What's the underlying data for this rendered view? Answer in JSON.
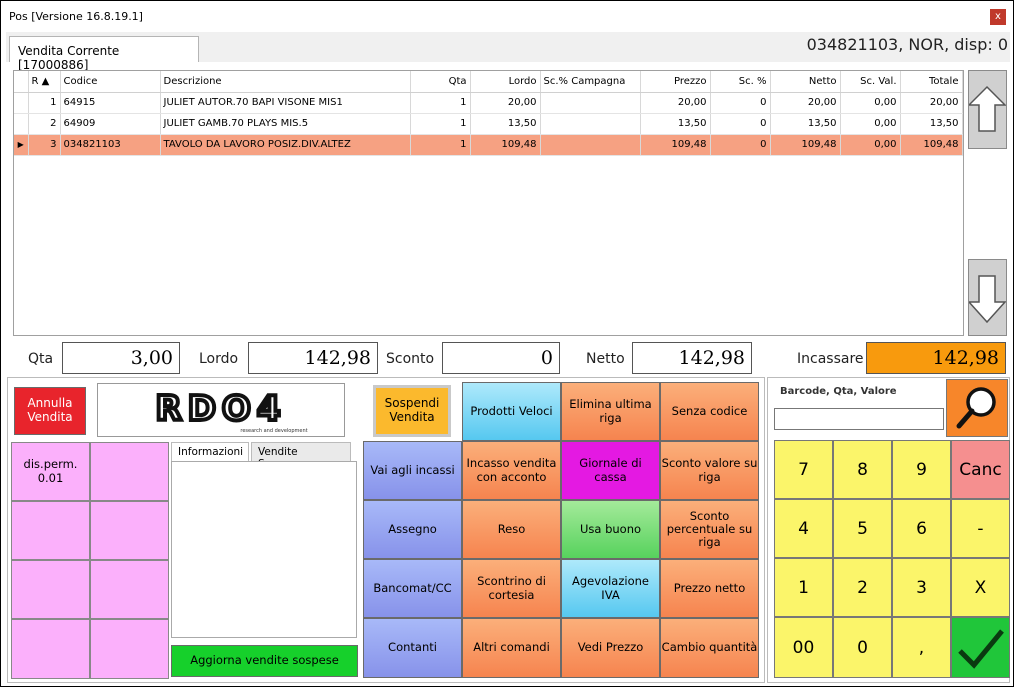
{
  "window": {
    "title": "Pos [Versione 16.8.19.1]",
    "close_glyph": "x"
  },
  "tab": {
    "label": "Vendita Corrente [17000886]"
  },
  "status_right": "034821103, NOR, disp: 0",
  "grid": {
    "columns": [
      "R",
      "Codice",
      "Descrizione",
      "Qta",
      "Lordo",
      "Sc.% Campagna",
      "Prezzo",
      "Sc. %",
      "Netto",
      "Sc. Val.",
      "Totale"
    ],
    "rows": [
      {
        "r": "1",
        "codice": "64915",
        "descrizione": "JULIET AUTOR.70 BAPI VISONE MIS1",
        "qta": "1",
        "lordo": "20,00",
        "sc_campagna": "",
        "prezzo": "20,00",
        "sc_pct": "0",
        "netto": "20,00",
        "sc_val": "0,00",
        "totale": "20,00"
      },
      {
        "r": "2",
        "codice": "64909",
        "descrizione": "JULIET GAMB.70 PLAYS MIS.5",
        "qta": "1",
        "lordo": "13,50",
        "sc_campagna": "",
        "prezzo": "13,50",
        "sc_pct": "0",
        "netto": "13,50",
        "sc_val": "0,00",
        "totale": "13,50"
      },
      {
        "r": "3",
        "codice": "034821103",
        "descrizione": "TAVOLO DA LAVORO POSIZ.DIV.ALTEZ",
        "qta": "1",
        "lordo": "109,48",
        "sc_campagna": "",
        "prezzo": "109,48",
        "sc_pct": "0",
        "netto": "109,48",
        "sc_val": "0,00",
        "totale": "109,48"
      }
    ],
    "selected_row_color": "#f6a182"
  },
  "totals": {
    "qta_label": "Qta",
    "qta_value": "3,00",
    "lordo_label": "Lordo",
    "lordo_value": "142,98",
    "sconto_label": "Sconto",
    "sconto_value": "0",
    "netto_label": "Netto",
    "netto_value": "142,98",
    "incassare_label": "Incassare",
    "incassare_value": "142,98"
  },
  "actions": {
    "annulla": "Annulla Vendita",
    "sospendi": "Sospendi Vendita",
    "logo_text": "RDO4",
    "logo_sub": "research and development",
    "dis_perm": "dis.perm. 0.01"
  },
  "info": {
    "tab1": "Informazioni",
    "tab2": "Vendite Sospese",
    "aggiorna": "Aggiorna vendite sospese"
  },
  "commands": {
    "prodotti_veloci": "Prodotti Veloci",
    "elimina_ultima_riga": "Elimina ultima riga",
    "senza_codice": "Senza codice",
    "vai_agli_incassi": "Vai agli incassi",
    "incasso_acconto": "Incasso vendita con acconto",
    "giornale_cassa": "Giornale di cassa",
    "sconto_valore": "Sconto valore su riga",
    "assegno": "Assegno",
    "reso": "Reso",
    "usa_buono": "Usa buono",
    "sconto_percentuale": "Sconto percentuale su riga",
    "bancomat": "Bancomat/CC",
    "scontrino_cortesia": "Scontrino di cortesia",
    "agevolazione_iva": "Agevolazione IVA",
    "prezzo_netto": "Prezzo netto",
    "contanti": "Contanti",
    "altri_comandi": "Altri comandi",
    "vedi_prezzo": "Vedi Prezzo",
    "cambio_quantita": "Cambio quantità"
  },
  "keypad": {
    "barcode_label": "Barcode, Qta, Valore",
    "keys": [
      "7",
      "8",
      "9",
      "Canc",
      "4",
      "5",
      "6",
      "-",
      "1",
      "2",
      "3",
      "X",
      "00",
      "0",
      ","
    ]
  }
}
